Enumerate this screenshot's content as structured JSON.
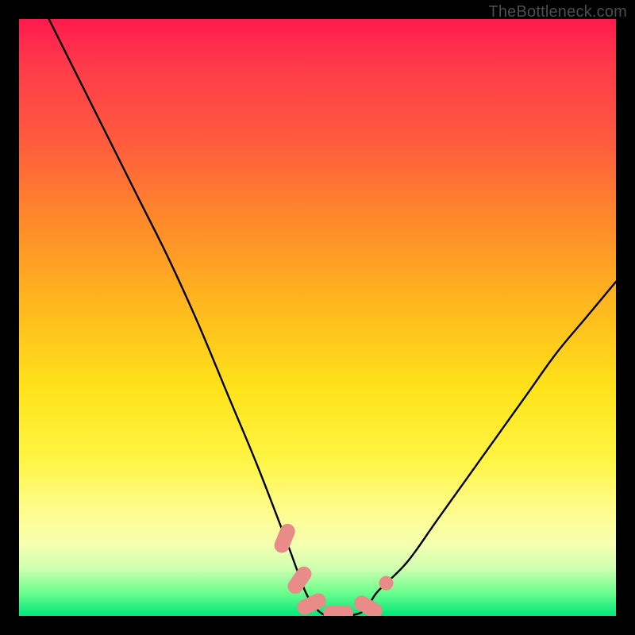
{
  "attribution": "TheBottleneck.com",
  "chart_data": {
    "type": "line",
    "title": "",
    "xlabel": "",
    "ylabel": "",
    "xlim": [
      0,
      100
    ],
    "ylim": [
      0,
      100
    ],
    "series": [
      {
        "name": "bottleneck-curve",
        "x": [
          5,
          10,
          15,
          20,
          25,
          30,
          35,
          40,
          45,
          48,
          50,
          52,
          55,
          58,
          60,
          65,
          70,
          75,
          80,
          85,
          90,
          95,
          100
        ],
        "values": [
          100,
          90,
          80,
          70,
          60,
          49,
          37,
          25,
          12,
          4,
          1,
          0,
          0,
          1,
          4,
          9,
          16,
          23,
          30,
          37,
          44,
          50,
          56
        ]
      }
    ],
    "markers": [
      {
        "name": "pill-1",
        "x": 44.5,
        "y": 13,
        "shape": "pill",
        "angle": -68
      },
      {
        "name": "pill-2",
        "x": 47.0,
        "y": 6,
        "shape": "pill",
        "angle": -55
      },
      {
        "name": "pill-3",
        "x": 49.0,
        "y": 2,
        "shape": "pill",
        "angle": -25
      },
      {
        "name": "pill-4",
        "x": 53.5,
        "y": 0.5,
        "shape": "pill",
        "angle": 0
      },
      {
        "name": "pill-5",
        "x": 58.5,
        "y": 1.5,
        "shape": "pill",
        "angle": 30
      },
      {
        "name": "dot-1",
        "x": 61.5,
        "y": 5.5,
        "shape": "dot"
      }
    ],
    "gradient_stops": [
      {
        "pos": 0,
        "color": "#ff1a4d"
      },
      {
        "pos": 34,
        "color": "#ff8a2a"
      },
      {
        "pos": 62,
        "color": "#ffe31a"
      },
      {
        "pos": 88,
        "color": "#f5ffb0"
      },
      {
        "pos": 100,
        "color": "#00e77a"
      }
    ]
  }
}
